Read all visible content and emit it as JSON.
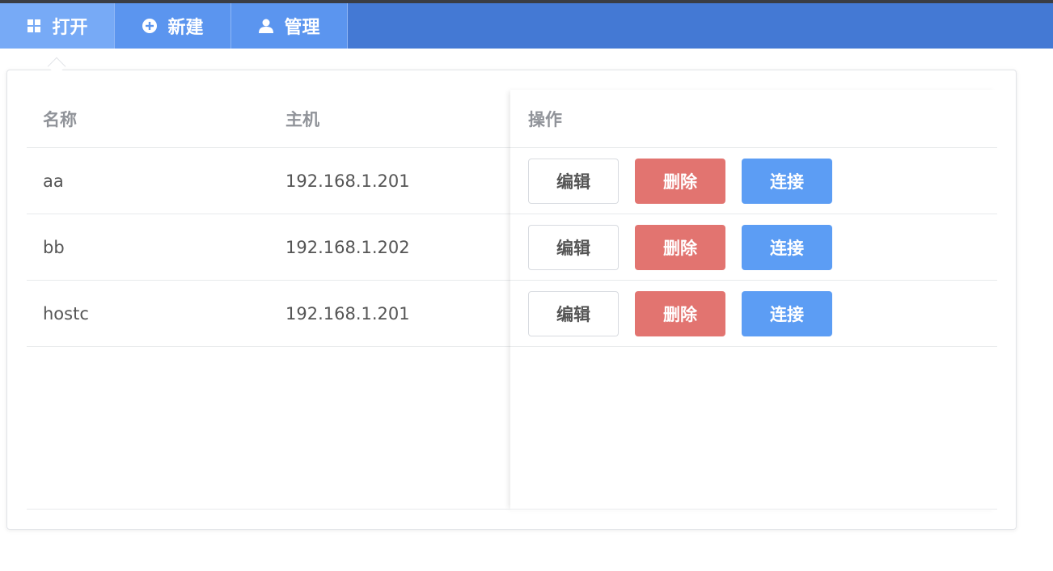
{
  "nav": {
    "items": [
      {
        "label": "打开",
        "icon": "grid-icon",
        "active": true
      },
      {
        "label": "新建",
        "icon": "plus-circle-icon",
        "active": false
      },
      {
        "label": "管理",
        "icon": "user-icon",
        "active": false
      }
    ]
  },
  "table": {
    "headers": {
      "name": "名称",
      "host": "主机",
      "ops": "操作"
    },
    "rows": [
      {
        "name": "aa",
        "host": "192.168.1.201"
      },
      {
        "name": "bb",
        "host": "192.168.1.202"
      },
      {
        "name": "hostc",
        "host": "192.168.1.201"
      }
    ],
    "buttons": {
      "edit": "编辑",
      "delete": "删除",
      "connect": "连接"
    }
  },
  "colors": {
    "topbar": "#4479d4",
    "nav_button": "#5b95ef",
    "nav_active": "#77aaf6",
    "danger": "#e27470",
    "primary": "#5c9df4"
  }
}
